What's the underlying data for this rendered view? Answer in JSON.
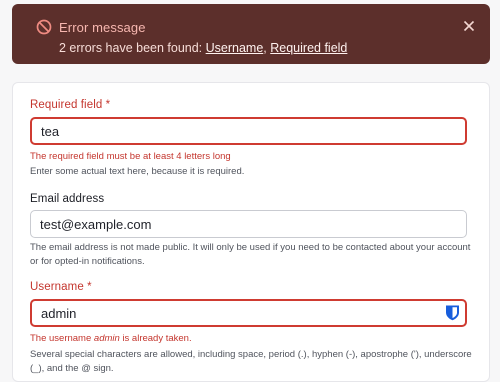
{
  "banner": {
    "title": "Error message",
    "prefix": "2 errors have been found: ",
    "links": [
      "Username",
      "Required field"
    ],
    "separator": ", "
  },
  "form": {
    "required_field": {
      "label": "Required field",
      "required_mark": "*",
      "value": "tea",
      "error": "The required field must be at least 4 letters long",
      "help": "Enter some actual text here, because it is required."
    },
    "email": {
      "label": "Email address",
      "value": "test@example.com",
      "help": "The email address is not made public. It will only be used if you need to be contacted about your account or for opted-in notifications."
    },
    "username": {
      "label": "Username",
      "required_mark": "*",
      "value": "admin",
      "error_prefix": "The username ",
      "error_value": "admin",
      "error_suffix": " is already taken.",
      "help": "Several special characters are allowed, including space, period (.), hyphen (-), apostrophe ('), underscore (_), and the @ sign."
    }
  },
  "colors": {
    "banner_bg": "#5c2f2b",
    "error_red": "#c4362e",
    "shield_blue": "#175ddc"
  }
}
